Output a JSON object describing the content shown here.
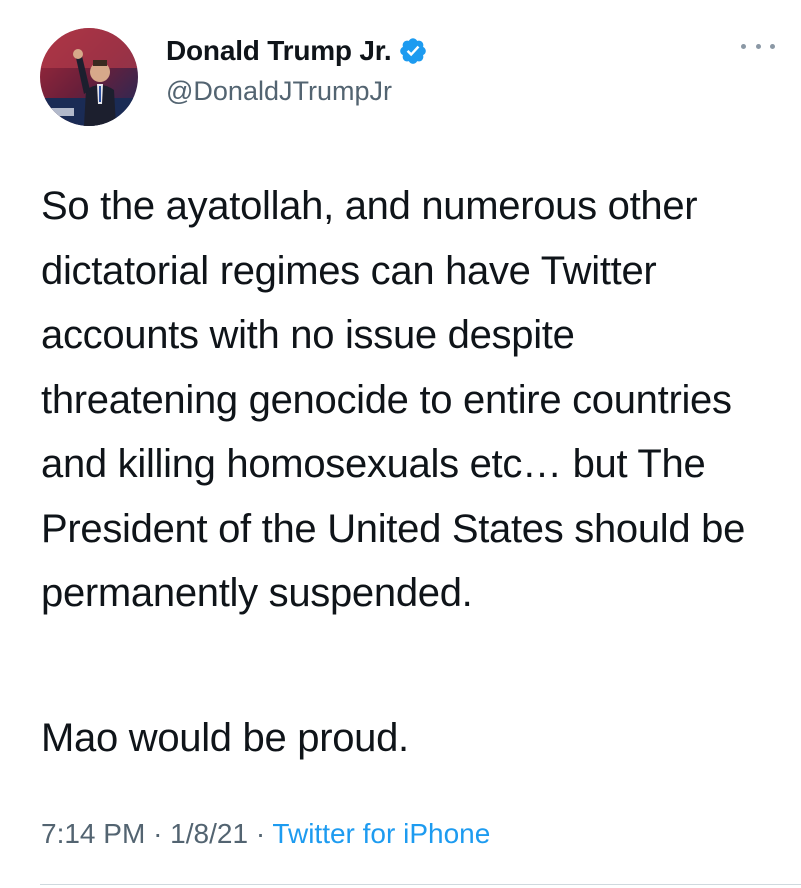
{
  "author": {
    "display_name": "Donald Trump Jr.",
    "handle": "@DonaldJTrumpJr",
    "verified": true,
    "verified_icon": "verified-badge-icon",
    "verified_color": "#1d9bf0"
  },
  "tweet": {
    "text_main": "So the ayatollah, and numerous other dictatorial regimes can have Twitter accounts with no issue despite threatening genocide to entire countries and killing homosexuals etc… but The President of the United States should be permanently suspended.",
    "text_closing": "Mao would be proud.",
    "time": "7:14 PM",
    "separator": "·",
    "date": "1/8/21",
    "source": "Twitter for iPhone"
  },
  "actions": {
    "more_icon": "more-options-icon"
  },
  "colors": {
    "text": "#0f1419",
    "secondary": "#536471",
    "link": "#1d9bf0",
    "divider": "#cfd9de"
  }
}
